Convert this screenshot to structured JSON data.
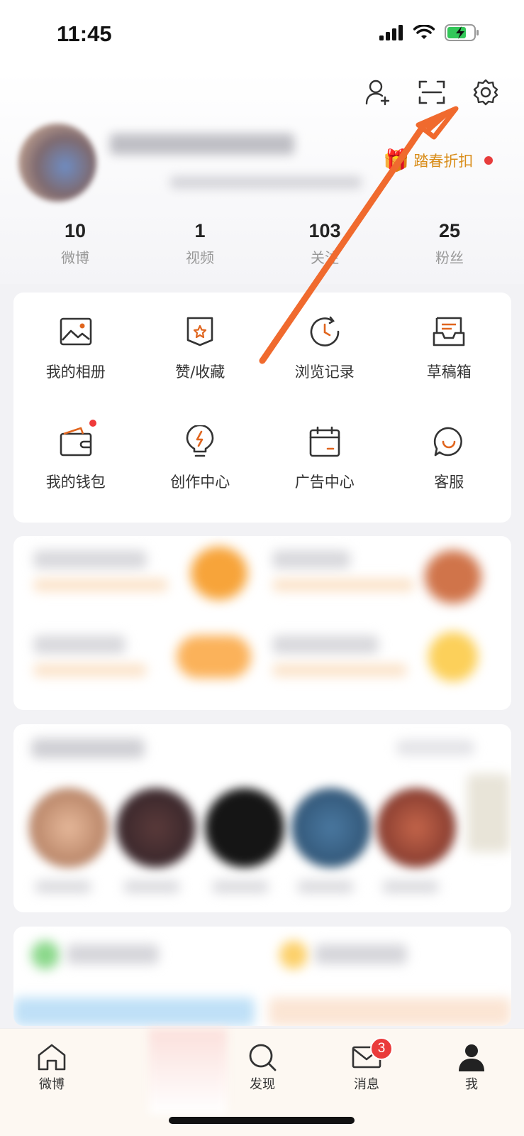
{
  "status_bar": {
    "time": "11:45"
  },
  "top_actions": [
    "add-friend-icon",
    "scan-icon",
    "settings-icon"
  ],
  "profile": {
    "promo_text": "踏春折扣"
  },
  "stats": [
    {
      "num": "10",
      "label": "微博"
    },
    {
      "num": "1",
      "label": "视频"
    },
    {
      "num": "103",
      "label": "关注"
    },
    {
      "num": "25",
      "label": "粉丝"
    }
  ],
  "menu": {
    "items": [
      {
        "label": "我的相册",
        "icon": "photo-album-icon"
      },
      {
        "label": "赞/收藏",
        "icon": "favorite-icon"
      },
      {
        "label": "浏览记录",
        "icon": "history-icon"
      },
      {
        "label": "草稿箱",
        "icon": "drafts-icon"
      },
      {
        "label": "我的钱包",
        "icon": "wallet-icon"
      },
      {
        "label": "创作中心",
        "icon": "creator-center-icon"
      },
      {
        "label": "广告中心",
        "icon": "ad-center-icon"
      },
      {
        "label": "客服",
        "icon": "customer-service-icon"
      }
    ]
  },
  "tabs": [
    {
      "label": "微博",
      "icon": "home-icon"
    },
    {
      "label": "发现",
      "icon": "discover-icon"
    },
    {
      "label": "消息",
      "icon": "message-icon",
      "badge": "3"
    },
    {
      "label": "我",
      "icon": "profile-icon"
    }
  ],
  "colors": {
    "accent": "#e0651e",
    "badge": "#ea3b3b",
    "promo": "#d98d1a"
  }
}
